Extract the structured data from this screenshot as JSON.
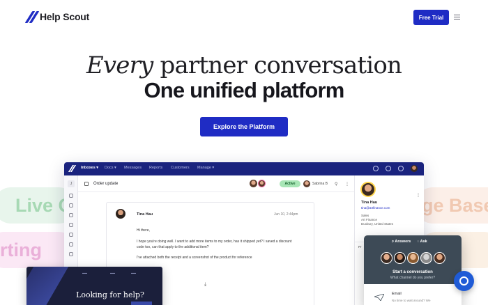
{
  "nav": {
    "brand": "Help Scout",
    "trial_label": "Free Trial"
  },
  "hero": {
    "line1_em": "Every",
    "line1_rest": " partner conversation",
    "line2": "One unified platform",
    "cta_label": "Explore the Platform"
  },
  "background_pills": {
    "live": "Live C",
    "rting": "rting",
    "base": "ge Base",
    "t": "t"
  },
  "app": {
    "menu": [
      "Inboxes ▾",
      "Docs ▾",
      "Messages",
      "Reports",
      "Customers",
      "Manage ▾"
    ],
    "sidebar_initial": "J",
    "conversation": {
      "title": "Order update",
      "status": "Active",
      "assignee": "Sabrina B",
      "sender": "Tina Hau",
      "date": "Jun 10, 2:44pm",
      "greeting": "Hi there,",
      "body_lines": [
        "I hope you're doing well. I want to add more items to my order, has it shipped yet? I saved a discount",
        "code too, can that apply to the additional item?",
        "I've attached both the receipt and a screenshot of the product for reference"
      ]
    },
    "profile": {
      "name": "Tina Hau",
      "email": "tina@artfinance.com",
      "role": "Sales",
      "company": "Art Finance",
      "location": "Duxbury, United States",
      "section_label": "Pr"
    }
  },
  "widget": {
    "tab_answers": "Answers",
    "tab_ask": "Ask",
    "title": "Start a conversation",
    "subtitle": "What channel do you prefer?",
    "email_label": "Email",
    "email_wait": "No time to wait around? We"
  },
  "help_card": {
    "title": "Looking for help?"
  },
  "colors": {
    "brand": "#1f2cc4",
    "app_bar": "#1a237e",
    "active_badge": "#a8e6b6",
    "beacon": "#1f5bd6"
  }
}
